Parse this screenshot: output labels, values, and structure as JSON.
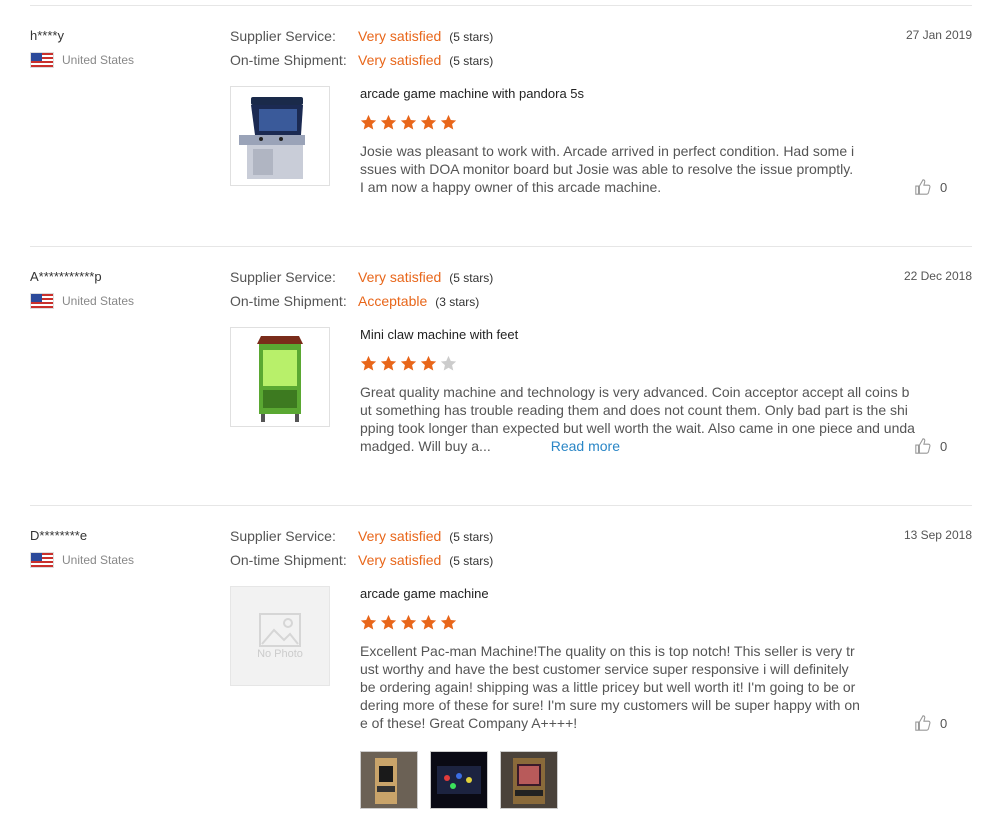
{
  "labels": {
    "supplier_service": "Supplier Service:",
    "ontime_shipment": "On-time Shipment:",
    "read_more": "Read more",
    "no_photo": "No Photo"
  },
  "colors": {
    "accent": "#e8661a",
    "link": "#2a86c6",
    "star_empty": "#cccccc"
  },
  "reviews": [
    {
      "user": "h****y",
      "country": "United States",
      "date": "27 Jan 2019",
      "supplier_service": "Very satisfied",
      "supplier_stars": "(5 stars)",
      "shipment": "Very satisfied",
      "shipment_stars": "(5 stars)",
      "product_title": "arcade game machine with pandora 5s",
      "rating": 5,
      "text": "Josie was pleasant to work with. Arcade arrived in perfect condition. Had some issues with DOA monitor board but Josie was able to resolve the issue promptly. I am now a happy owner of this arcade machine.",
      "likes": "0"
    },
    {
      "user": "A***********p",
      "country": "United States",
      "date": "22 Dec 2018",
      "supplier_service": "Very satisfied",
      "supplier_stars": "(5 stars)",
      "shipment": "Acceptable",
      "shipment_stars": "(3 stars)",
      "product_title": "Mini claw machine with feet",
      "rating": 4,
      "text": "Great quality machine and technology is very advanced. Coin acceptor accept all coins but something has trouble reading them and does not count them. Only bad part is the shipping took longer than expected but well worth the wait. Also came in one piece and undamadged. Will buy a...",
      "likes": "0"
    },
    {
      "user": "D********e",
      "country": "United States",
      "date": "13 Sep 2018",
      "supplier_service": "Very satisfied",
      "supplier_stars": "(5 stars)",
      "shipment": "Very satisfied",
      "shipment_stars": "(5 stars)",
      "product_title": "arcade game machine",
      "rating": 5,
      "text": "Excellent Pac-man Machine!The quality on this is top notch! This seller is very trust worthy and have the best customer service super responsive i will definitely be ordering again! shipping was a little pricey but well worth it! I'm going to be ordering more of these for sure! I'm sure my customers will be super happy with one of these! Great Company A++++!",
      "likes": "0"
    }
  ]
}
